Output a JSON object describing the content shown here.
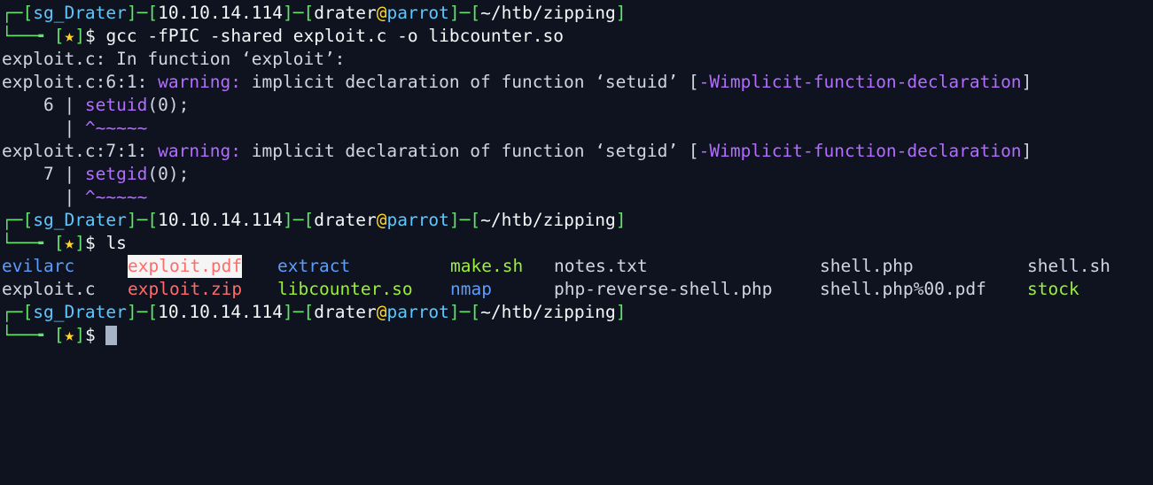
{
  "prompt": {
    "corner_top": "┌─[",
    "user": "sg_Drater",
    "sep1": "]─[",
    "ip": "10.10.14.114",
    "sep2": "]─[",
    "login_user": "drater",
    "at": "@",
    "host": "parrot",
    "sep3": "]─[",
    "path": "~/htb/zipping",
    "close": "]",
    "corner_bottom": "└──╼ ",
    "star_open": "[",
    "star": "★",
    "star_close": "]",
    "dollar": "$"
  },
  "command1": " gcc -fPIC -shared exploit.c -o libcounter.so",
  "gcc_output": {
    "in_function": "exploit.c: In function ‘exploit’:",
    "warnings": [
      {
        "location": "exploit.c:6:1: ",
        "label": "warning:",
        "message": " implicit declaration of function ‘setuid’ ",
        "flag_open": "[",
        "flag": "-Wimplicit-function-declaration",
        "flag_close": "]",
        "gutter": "    6 | ",
        "code_fn": "setuid",
        "code_rest": "(0);",
        "caret_gutter": "      | ",
        "caret": "^~~~~~"
      },
      {
        "location": "exploit.c:7:1: ",
        "label": "warning:",
        "message": " implicit declaration of function ‘setgid’ ",
        "flag_open": "[",
        "flag": "-Wimplicit-function-declaration",
        "flag_close": "]",
        "gutter": "    7 | ",
        "code_fn": "setgid",
        "code_rest": "(0);",
        "caret_gutter": "      | ",
        "caret": "^~~~~~"
      }
    ]
  },
  "command2": " ls",
  "ls": {
    "row1": [
      "evilarc",
      "exploit.pdf",
      "extract",
      "make.sh",
      "notes.txt",
      "shell.php",
      "shell.sh"
    ],
    "row2": [
      "exploit.c",
      "exploit.zip",
      "libcounter.so",
      "nmap",
      "php-reverse-shell.php",
      "shell.php%00.pdf",
      "stock"
    ]
  },
  "colors": {
    "background": "#0e131f",
    "prompt_frame": "#ff3b3b",
    "prompt_user": "#5bc8ff",
    "prompt_host": "#5bc8ff",
    "star": "#ffd72a",
    "warning": "#b26dff",
    "caret": "#b26dff",
    "directory": "#5b9dff",
    "executable": "#9bee3a",
    "archive": "#ff6b6b"
  }
}
